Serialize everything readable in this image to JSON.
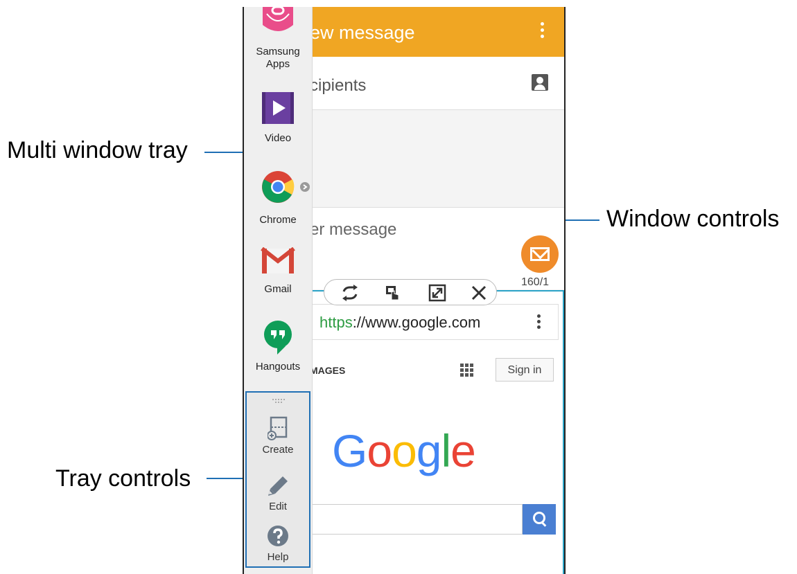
{
  "callouts": {
    "multi_window_tray": "Multi window tray",
    "window_controls": "Window controls",
    "tray_controls": "Tray controls"
  },
  "messages_window": {
    "title": "ew message",
    "recipients_placeholder": "cipients",
    "compose_placeholder": "er message",
    "char_count": "160/1"
  },
  "browser_window": {
    "url_scheme": "https",
    "url_rest": "://www.google.com",
    "tab_images": "MAGES",
    "sign_in": "Sign in",
    "logo_letters": [
      {
        "char": "G",
        "color": "#4285F4"
      },
      {
        "char": "o",
        "color": "#EA4335"
      },
      {
        "char": "o",
        "color": "#FBBC05"
      },
      {
        "char": "g",
        "color": "#4285F4"
      },
      {
        "char": "l",
        "color": "#34A853"
      },
      {
        "char": "e",
        "color": "#EA4335"
      }
    ]
  },
  "tray": {
    "apps": [
      {
        "label": "Samsung\nApps",
        "icon": "samsung-apps-icon"
      },
      {
        "label": "Video",
        "icon": "video-icon"
      },
      {
        "label": "Chrome",
        "icon": "chrome-icon"
      },
      {
        "label": "Gmail",
        "icon": "gmail-icon"
      },
      {
        "label": "Hangouts",
        "icon": "hangouts-icon"
      }
    ],
    "controls": [
      {
        "label": "Create",
        "icon": "create-icon"
      },
      {
        "label": "Edit",
        "icon": "pencil-icon"
      },
      {
        "label": "Help",
        "icon": "help-icon"
      }
    ]
  },
  "window_controls": [
    "switch-windows-icon",
    "drag-content-icon",
    "maximize-icon",
    "close-icon"
  ],
  "colors": {
    "accent_orange": "#f0a623",
    "callout_line": "#1f6fb4",
    "focus_border": "#2aa3c7",
    "search_blue": "#4a7fd2"
  }
}
